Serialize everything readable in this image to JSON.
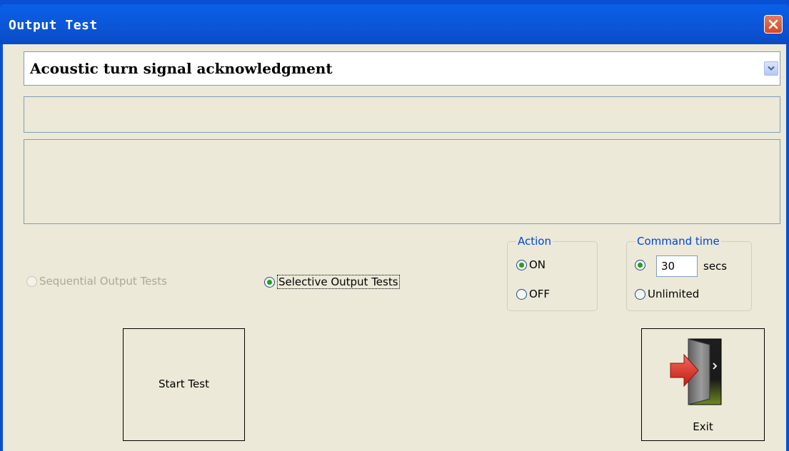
{
  "window": {
    "title": "Output Test"
  },
  "combo": {
    "selected": "Acoustic turn signal acknowledgment"
  },
  "test_mode": {
    "sequential_label": "Sequential Output Tests",
    "selective_label": "Selective Output Tests",
    "selected": "selective"
  },
  "action": {
    "legend": "Action",
    "on_label": "ON",
    "off_label": "OFF",
    "selected": "ON"
  },
  "command_time": {
    "legend": "Command time",
    "secs_value": "30",
    "secs_unit": "secs",
    "unlimited_label": "Unlimited",
    "selected": "secs"
  },
  "buttons": {
    "start_label": "Start Test",
    "exit_label": "Exit"
  },
  "colors": {
    "title_bar": "#0a55d6",
    "client_bg": "#ece9d8",
    "close_button": "#d24a26",
    "radio_check": "#21a121",
    "group_legend": "#0046d5"
  },
  "icons": {
    "close": "close-icon",
    "dropdown": "chevron-down-icon",
    "exit": "exit-door-icon"
  }
}
